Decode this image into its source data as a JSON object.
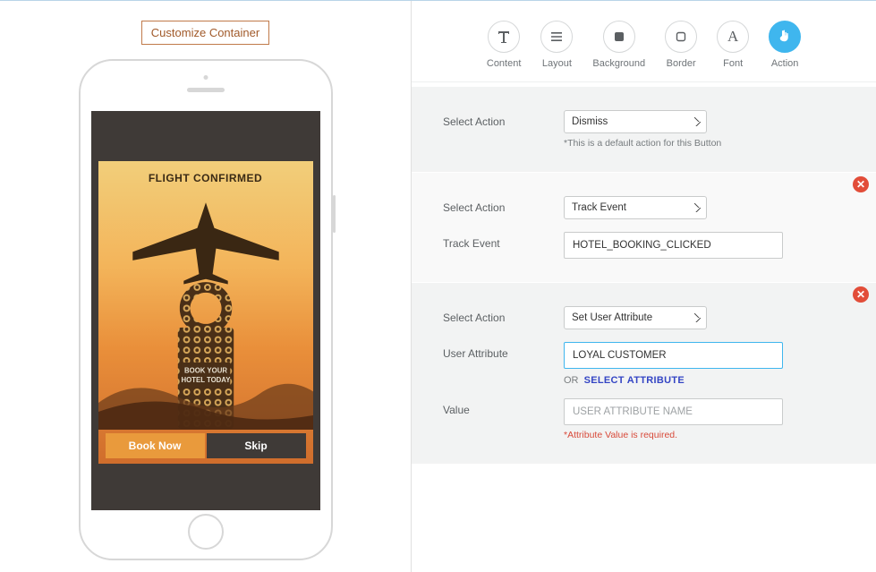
{
  "left": {
    "customize_btn": "Customize Container",
    "flight_title": "FLIGHT CONFIRMED",
    "door_text_1": "BOOK YOUR",
    "door_text_2": "HOTEL TODAY",
    "book_btn": "Book Now",
    "skip_btn": "Skip"
  },
  "tabs": [
    {
      "id": "content",
      "label": "Content",
      "icon": "text"
    },
    {
      "id": "layout",
      "label": "Layout",
      "icon": "lines"
    },
    {
      "id": "background",
      "label": "Background",
      "icon": "square-fill"
    },
    {
      "id": "border",
      "label": "Border",
      "icon": "square-outline"
    },
    {
      "id": "font",
      "label": "Font",
      "icon": "letter-a"
    },
    {
      "id": "action",
      "label": "Action",
      "icon": "pointer",
      "active": true
    }
  ],
  "labels": {
    "select_action": "Select Action",
    "track_event": "Track Event",
    "user_attribute": "User Attribute",
    "value": "Value",
    "or": "OR",
    "select_attribute": "SELECT ATTRIBUTE"
  },
  "block1": {
    "action_value": "Dismiss",
    "hint": "*This is a default action for this Button"
  },
  "block2": {
    "action_value": "Track Event",
    "event_value": "HOTEL_BOOKING_CLICKED"
  },
  "block3": {
    "action_value": "Set User Attribute",
    "attr_value": "LOYAL CUSTOMER",
    "value_placeholder": "USER ATTRIBUTE NAME",
    "err": "*Attribute Value is required."
  }
}
